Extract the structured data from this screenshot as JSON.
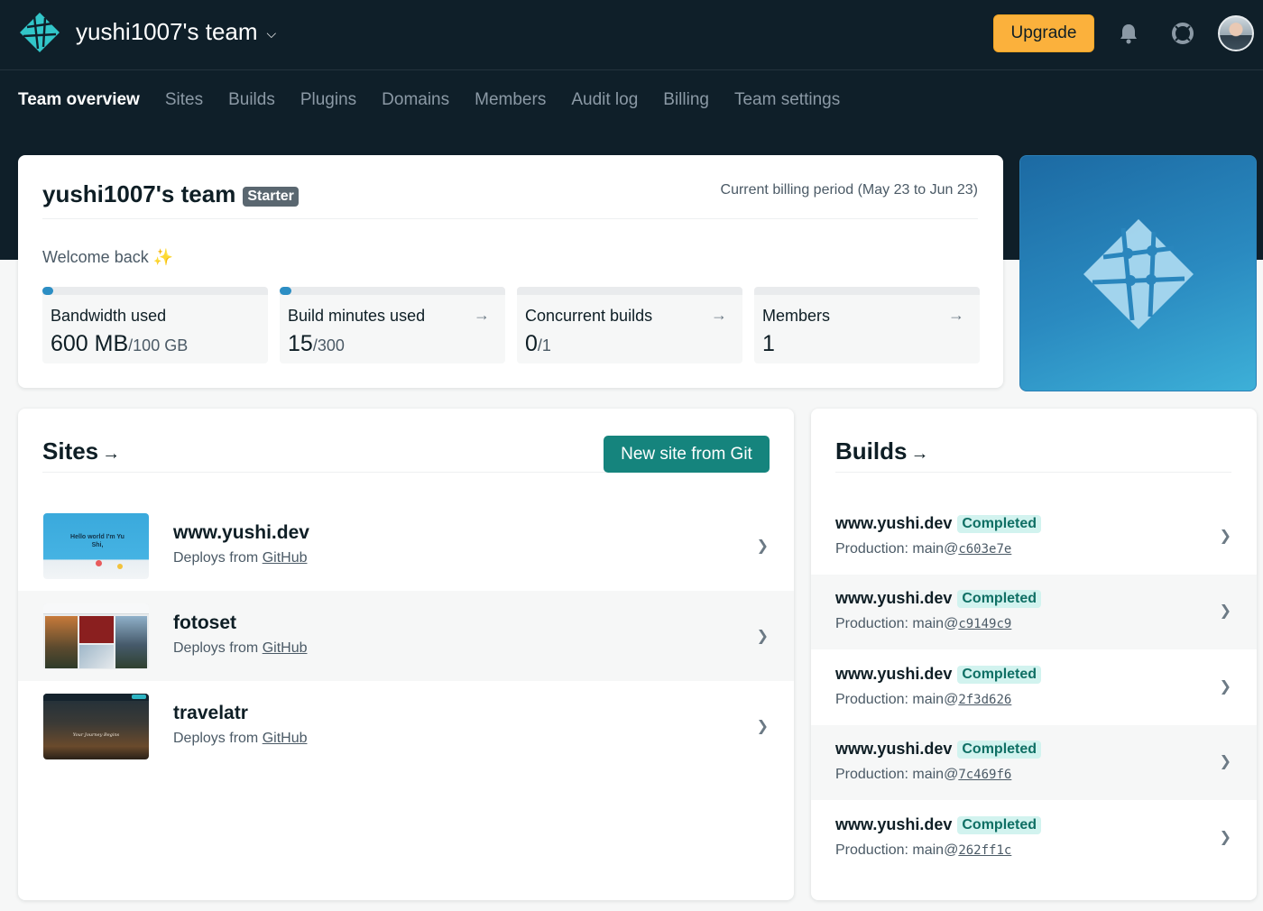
{
  "header": {
    "team_name": "yushi1007's team",
    "upgrade_label": "Upgrade"
  },
  "nav": {
    "tabs": [
      "Team overview",
      "Sites",
      "Builds",
      "Plugins",
      "Domains",
      "Members",
      "Audit log",
      "Billing",
      "Team settings"
    ],
    "active": "Team overview"
  },
  "overview": {
    "title": "yushi1007's team",
    "plan_badge": "Starter",
    "billing_period": "Current billing period (May 23 to Jun 23)",
    "welcome": "Welcome back",
    "welcome_emoji": "✨",
    "metrics": [
      {
        "label": "Bandwidth used",
        "value": "600 MB",
        "limit": "/100 GB",
        "usage": 0.006,
        "has_arrow": false
      },
      {
        "label": "Build minutes used",
        "value": "15",
        "limit": "/300",
        "usage": 0.05,
        "has_arrow": true
      },
      {
        "label": "Concurrent builds",
        "value": "0",
        "limit": "/1",
        "usage": 0,
        "has_arrow": true
      },
      {
        "label": "Members",
        "value": "1",
        "limit": "",
        "has_arrow": true
      }
    ]
  },
  "sites": {
    "title": "Sites",
    "new_site_label": "New site from Git",
    "items": [
      {
        "name": "www.yushi.dev",
        "deploy_prefix": "Deploys from ",
        "deploy_source": "GitHub",
        "thumb_text": "Hello world I'm Yu Shi,"
      },
      {
        "name": "fotoset",
        "deploy_prefix": "Deploys from ",
        "deploy_source": "GitHub"
      },
      {
        "name": "travelatr",
        "deploy_prefix": "Deploys from ",
        "deploy_source": "GitHub",
        "thumb_text": "Your Journey Begins"
      }
    ]
  },
  "builds": {
    "title": "Builds",
    "items": [
      {
        "site": "www.yushi.dev",
        "status": "Completed",
        "context": "Production: main@",
        "sha": "c603e7e"
      },
      {
        "site": "www.yushi.dev",
        "status": "Completed",
        "context": "Production: main@",
        "sha": "c9149c9"
      },
      {
        "site": "www.yushi.dev",
        "status": "Completed",
        "context": "Production: main@",
        "sha": "2f3d626"
      },
      {
        "site": "www.yushi.dev",
        "status": "Completed",
        "context": "Production: main@",
        "sha": "7c469f6"
      },
      {
        "site": "www.yushi.dev",
        "status": "Completed",
        "context": "Production: main@",
        "sha": "262ff1c"
      }
    ]
  },
  "icons": {
    "logo": "netlify-logo-icon",
    "bell": "bell-icon",
    "help": "lifebuoy-icon",
    "chevron": "chevron-right-icon",
    "arrow": "arrow-right-icon"
  },
  "colors": {
    "header_bg": "#0f1f29",
    "upgrade": "#fbb13c",
    "primary_button": "#15847d",
    "status_bg": "#d2f3ef",
    "status_text": "#0f6f64",
    "usage_bar": "#2c8ec4"
  }
}
